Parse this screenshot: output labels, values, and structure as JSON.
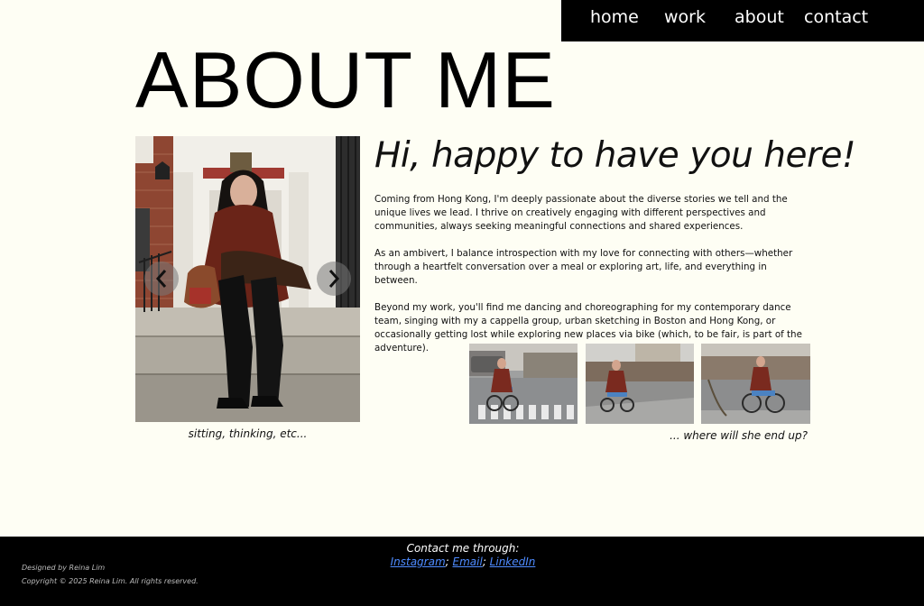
{
  "nav": {
    "items": [
      {
        "label": "home"
      },
      {
        "label": "work"
      },
      {
        "label": "about"
      },
      {
        "label": "contact"
      }
    ]
  },
  "page": {
    "title": "ABOUT ME",
    "greeting": "Hi, happy to have you here!"
  },
  "bio": {
    "paragraphs": [
      "Coming from Hong Kong, I'm deeply passionate about the diverse stories we tell and the unique lives we lead. I thrive on creatively engaging with different perspectives and communities, always seeking meaningful connections and shared experiences.",
      "As an ambivert, I balance introspection with my love for connecting with others—whether through a heartfelt conversation over a meal or exploring art, life, and everything in between.",
      "Beyond my work, you'll find me dancing and choreographing for my contemporary dance team, singing with my a cappella group, urban sketching in Boston and Hong Kong, or occasionally getting lost while exploring new places via bike (which, to be fair, is part of the adventure)."
    ]
  },
  "carousel": {
    "caption": "sitting, thinking, etc..."
  },
  "gallery": {
    "caption": "... where will she end up?"
  },
  "footer": {
    "contact_label": "Contact me through:",
    "links": {
      "instagram": "Instagram",
      "email": "Email",
      "linkedin": "LinkedIn",
      "separator": "; "
    },
    "designed_by": "Designed by Reina Lim",
    "copyright": "Copyright © 2025 Reina Lim. All rights reserved."
  },
  "colors": {
    "background": "#fefef4",
    "nav_bg": "#000000",
    "footer_bg": "#000000",
    "link": "#4e8bff"
  }
}
